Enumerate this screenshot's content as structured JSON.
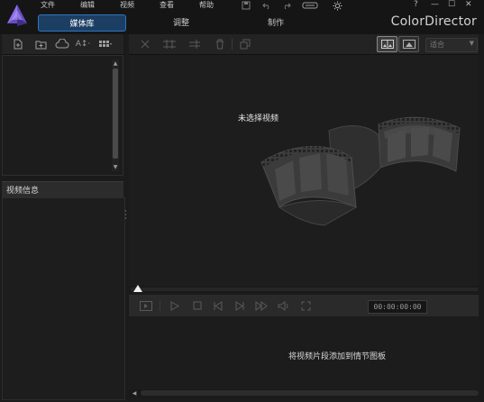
{
  "app": {
    "brand": "ColorDirector"
  },
  "menu": {
    "file": "文件",
    "edit": "编辑",
    "video": "视频",
    "view": "查看",
    "help": "帮助"
  },
  "window_controls": {
    "help": "?",
    "minimize": "—",
    "maximize": "☐",
    "close": "✕"
  },
  "tabs": {
    "media": "媒体库",
    "adjust": "调整",
    "produce": "制作"
  },
  "left_panel": {
    "info_header": "视频信息"
  },
  "preview": {
    "no_video": "未选择视频",
    "fit_label": "适合"
  },
  "player": {
    "timecode": "00:00:00:00"
  },
  "storyboard": {
    "hint": "将视频片段添加到情节图板"
  },
  "colors": {
    "accent": "#2f74c0",
    "tab_active_bg": "#1c3e63",
    "background": "#1b1b1b"
  },
  "icons": {
    "left_toolbar": [
      "import-file-icon",
      "import-folder-icon",
      "cloud-download-icon",
      "text-size-icon",
      "grid-view-icon"
    ],
    "right_toolbar": [
      "split-icon",
      "trim-icon",
      "join-icon",
      "delete-icon",
      "copy-icon",
      "split-view-icon",
      "single-view-icon"
    ],
    "player": [
      "clip-icon",
      "play-icon",
      "stop-icon",
      "previous-frame-icon",
      "next-frame-icon",
      "fast-forward-icon",
      "volume-icon",
      "fullscreen-icon"
    ]
  }
}
